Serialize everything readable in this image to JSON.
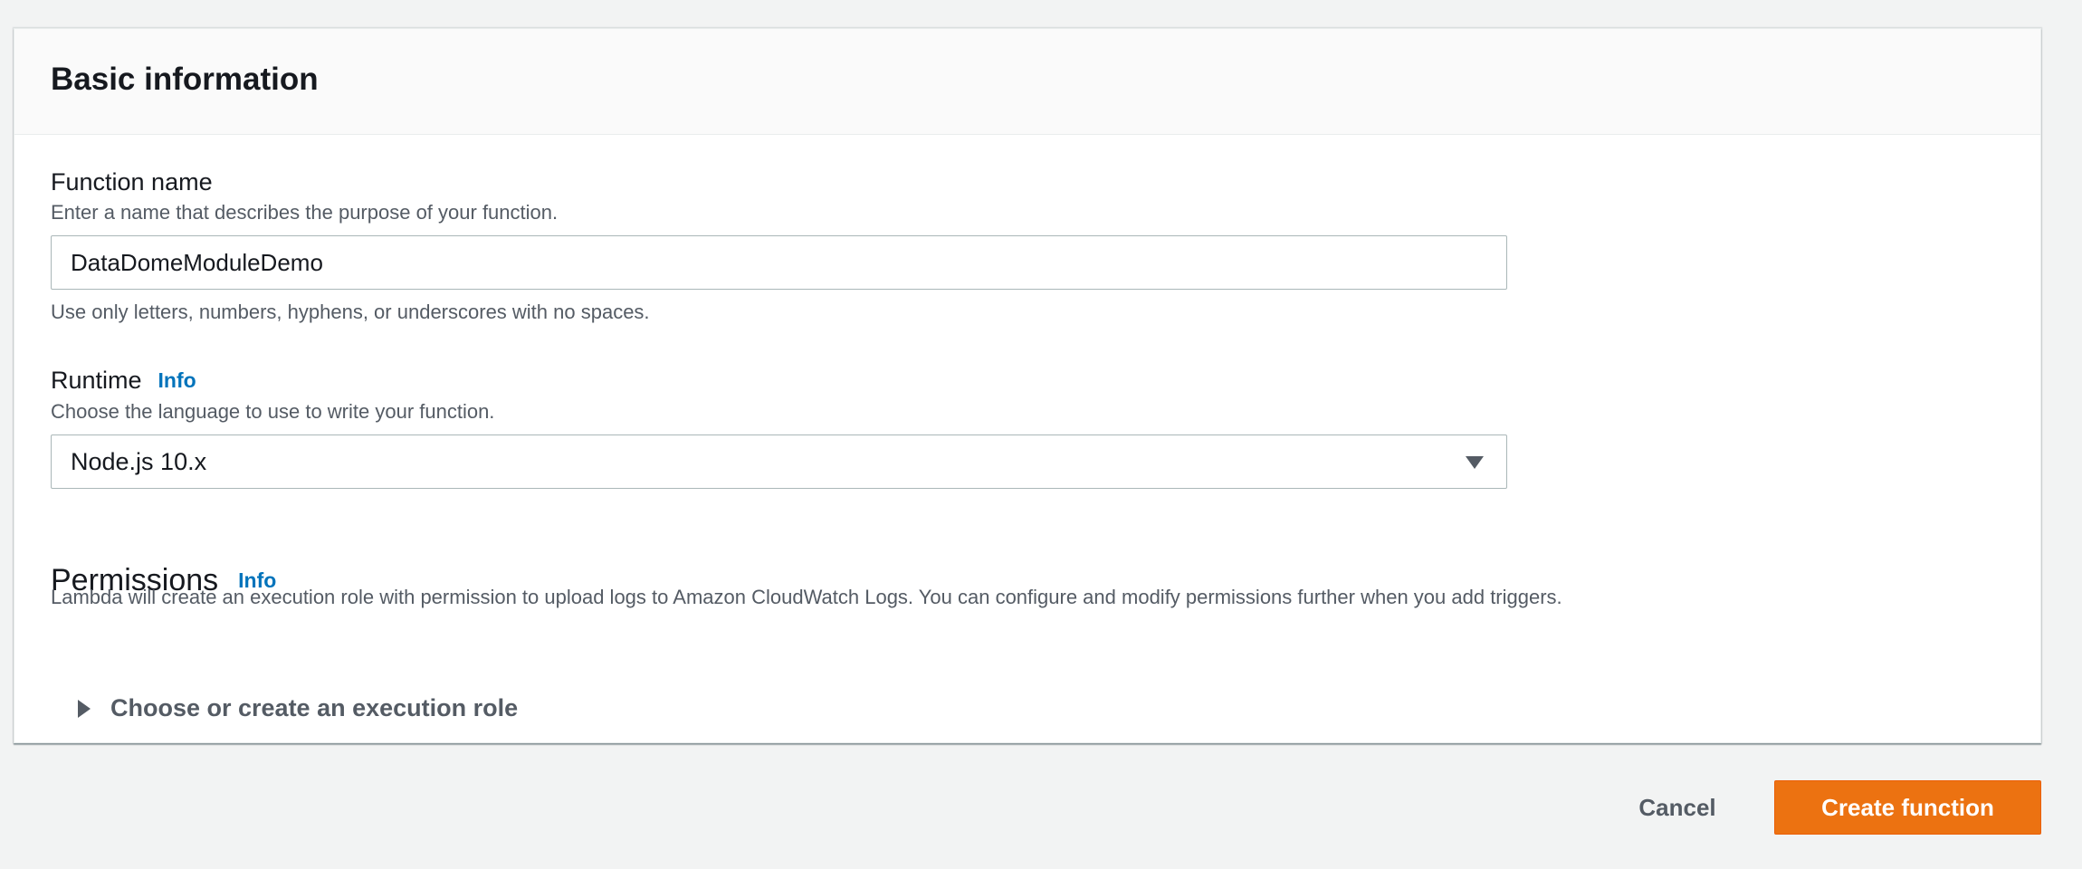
{
  "panel": {
    "title": "Basic information"
  },
  "function_name": {
    "label": "Function name",
    "description": "Enter a name that describes the purpose of your function.",
    "value": "DataDomeModuleDemo",
    "constraint": "Use only letters, numbers, hyphens, or underscores with no spaces."
  },
  "runtime": {
    "label": "Runtime",
    "info_label": "Info",
    "description": "Choose the language to use to write your function.",
    "selected": "Node.js 10.x"
  },
  "permissions": {
    "heading": "Permissions",
    "info_label": "Info",
    "description": "Lambda will create an execution role with permission to upload logs to Amazon CloudWatch Logs. You can configure and modify permissions further when you add triggers.",
    "expander_label": "Choose or create an execution role"
  },
  "actions": {
    "cancel_label": "Cancel",
    "create_label": "Create function"
  },
  "colors": {
    "page_bg": "#f2f3f3",
    "link": "#0073bb",
    "primary_button": "#ec7211",
    "secondary_text": "#545b64"
  },
  "icons": {
    "select_caret": "caret-down-icon",
    "expander_caret": "caret-right-icon"
  }
}
